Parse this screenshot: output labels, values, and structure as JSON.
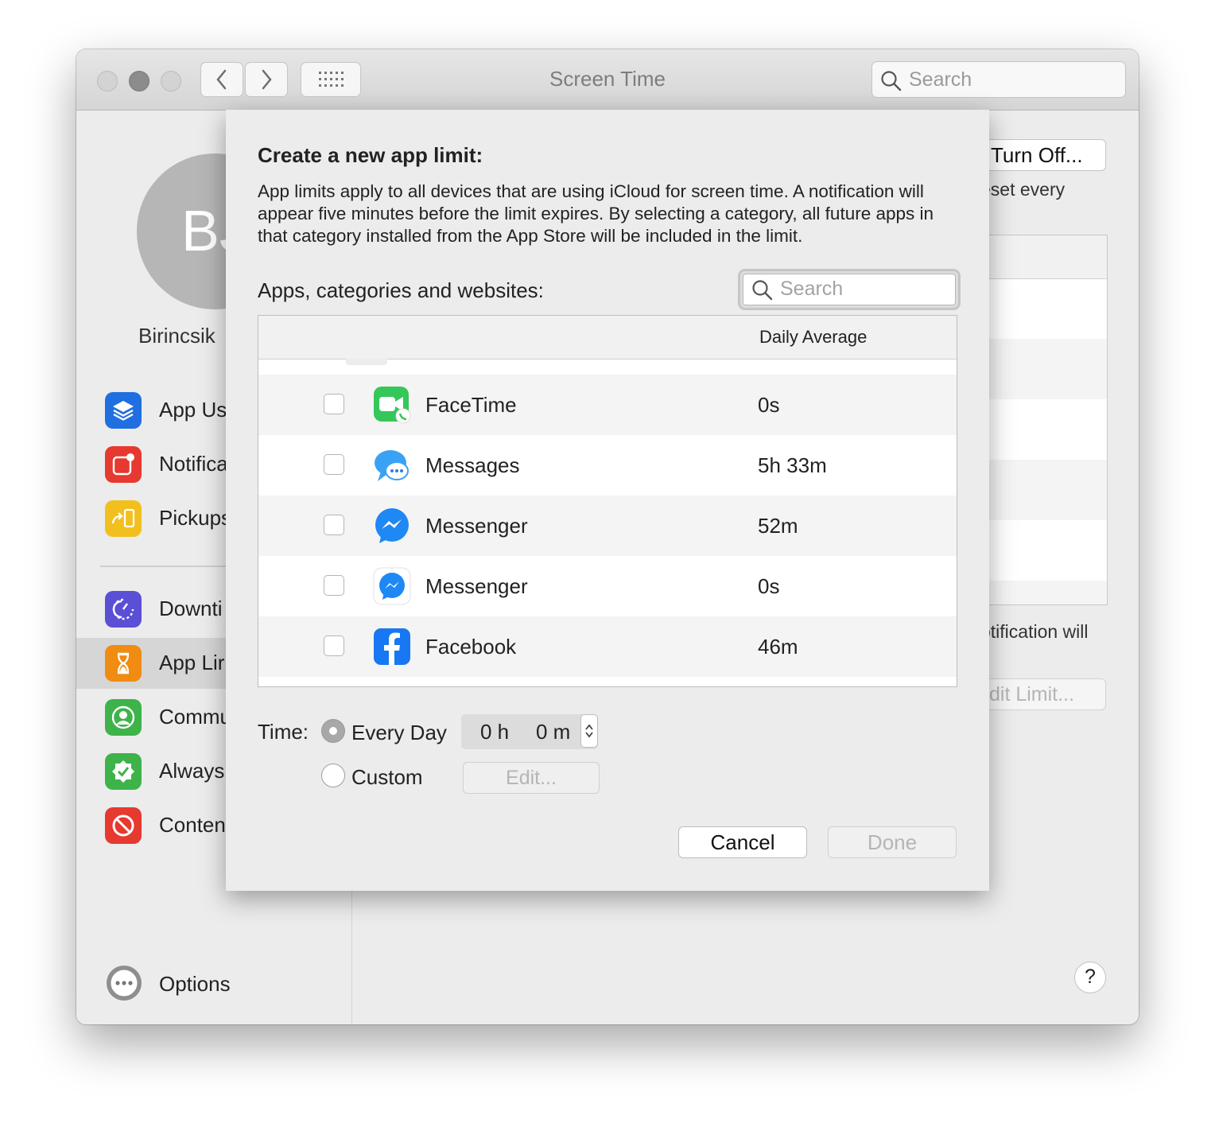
{
  "window": {
    "title": "Screen Time",
    "search_placeholder": "Search"
  },
  "sidebar": {
    "avatar_initials": "BJ",
    "user_name": "Birincsik",
    "items": [
      {
        "label": "App Us",
        "icon": "layers-icon",
        "color": "#1f6fe0"
      },
      {
        "label": "Notifica",
        "icon": "notification-badge-icon",
        "color": "#e6392f"
      },
      {
        "label": "Pickups",
        "icon": "pickup-phone-icon",
        "color": "#f2c01e"
      },
      {
        "label": "Downti",
        "icon": "downtime-moon-icon",
        "color": "#5b4fd6"
      },
      {
        "label": "App Lir",
        "icon": "hourglass-icon",
        "color": "#f08c12"
      },
      {
        "label": "Commu",
        "icon": "person-circle-icon",
        "color": "#3db34a"
      },
      {
        "label": "Always",
        "icon": "checkmark-seal-icon",
        "color": "#3db34a"
      },
      {
        "label": "Conten",
        "icon": "prohibited-icon",
        "color": "#e6392f"
      }
    ],
    "options_label": "Options"
  },
  "main": {
    "turn_off_label": "Turn Off...",
    "reset_text": "eset every",
    "notification_text": "otification will",
    "edit_limit_label": "dit Limit...",
    "help_label": "?"
  },
  "sheet": {
    "title": "Create a new app limit:",
    "description": "App limits apply to all devices that are using iCloud for screen time. A notification will appear five minutes before the limit expires. By selecting a category, all future apps in that category installed from the App Store will be included in the limit.",
    "apps_label": "Apps, categories and websites:",
    "search_placeholder": "Search",
    "table": {
      "column_header": "Daily Average",
      "rows": [
        {
          "name": "FaceTime",
          "average": "0s",
          "icon": "facetime-icon",
          "checked": false
        },
        {
          "name": "Messages",
          "average": "5h 33m",
          "icon": "messages-icon",
          "checked": false
        },
        {
          "name": "Messenger",
          "average": "52m",
          "icon": "messenger-icon",
          "checked": false
        },
        {
          "name": "Messenger",
          "average": "0s",
          "icon": "messenger-icon",
          "checked": false
        },
        {
          "name": "Facebook",
          "average": "46m",
          "icon": "facebook-icon",
          "checked": false
        }
      ]
    },
    "time": {
      "label": "Time:",
      "every_day_label": "Every Day",
      "custom_label": "Custom",
      "selected": "Every Day",
      "hours": "0 h",
      "minutes": "0 m",
      "edit_label": "Edit..."
    },
    "cancel_label": "Cancel",
    "done_label": "Done"
  }
}
